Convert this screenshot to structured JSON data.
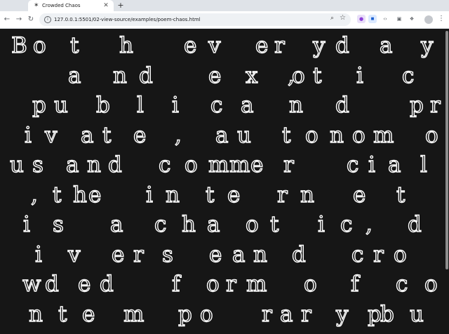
{
  "browser": {
    "tab": {
      "title": "Crowded Chaos",
      "favicon_icon": "code-icon",
      "close_icon": "close-icon"
    },
    "new_tab_icon": "plus-icon",
    "nav": {
      "back_icon": "arrow-left-icon",
      "forward_icon": "arrow-right-icon",
      "reload_icon": "reload-icon"
    },
    "address": {
      "url": "127.0.0.1:5501/02-view-source/examples/poem-chaos.html",
      "zoom_icon": "zoom-icon",
      "bookmark_icon": "star-icon"
    },
    "extensions": [
      "extension-icon",
      "extension-icon",
      "extension-icon",
      "extension-icon",
      "puzzle-icon"
    ],
    "menu_icon": "kebab-menu-icon"
  },
  "page": {
    "background": "#161616",
    "letter_color": "#ffffff",
    "poem_lines": [
      "B o t  h  ev er yd a y",
      "a nd  e x oti c ,",
      "pu b l i c a n d  pr",
      "iv at e , au to nom o",
      "us and c omme r c ial",
      ",the in te r n e t",
      "i s a c ha ot ic , d",
      "i v er s e an d cro",
      "wd ed f or m o f c o",
      "n te m po rar y pu b"
    ]
  }
}
